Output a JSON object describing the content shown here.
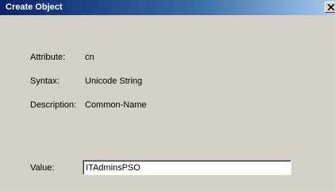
{
  "window": {
    "title": "Create Object"
  },
  "fields": {
    "attribute_label": "Attribute:",
    "attribute_value": "cn",
    "syntax_label": "Syntax:",
    "syntax_value": "Unicode String",
    "description_label": "Description:",
    "description_value": "Common-Name",
    "value_label": "Value:",
    "value_input": "ITAdminsPSO"
  },
  "colors": {
    "titlebar_start": "#0a246a",
    "titlebar_end": "#a6caf0",
    "dialog_background": "#d4d0c8"
  },
  "icons": {
    "close": "close-icon"
  }
}
